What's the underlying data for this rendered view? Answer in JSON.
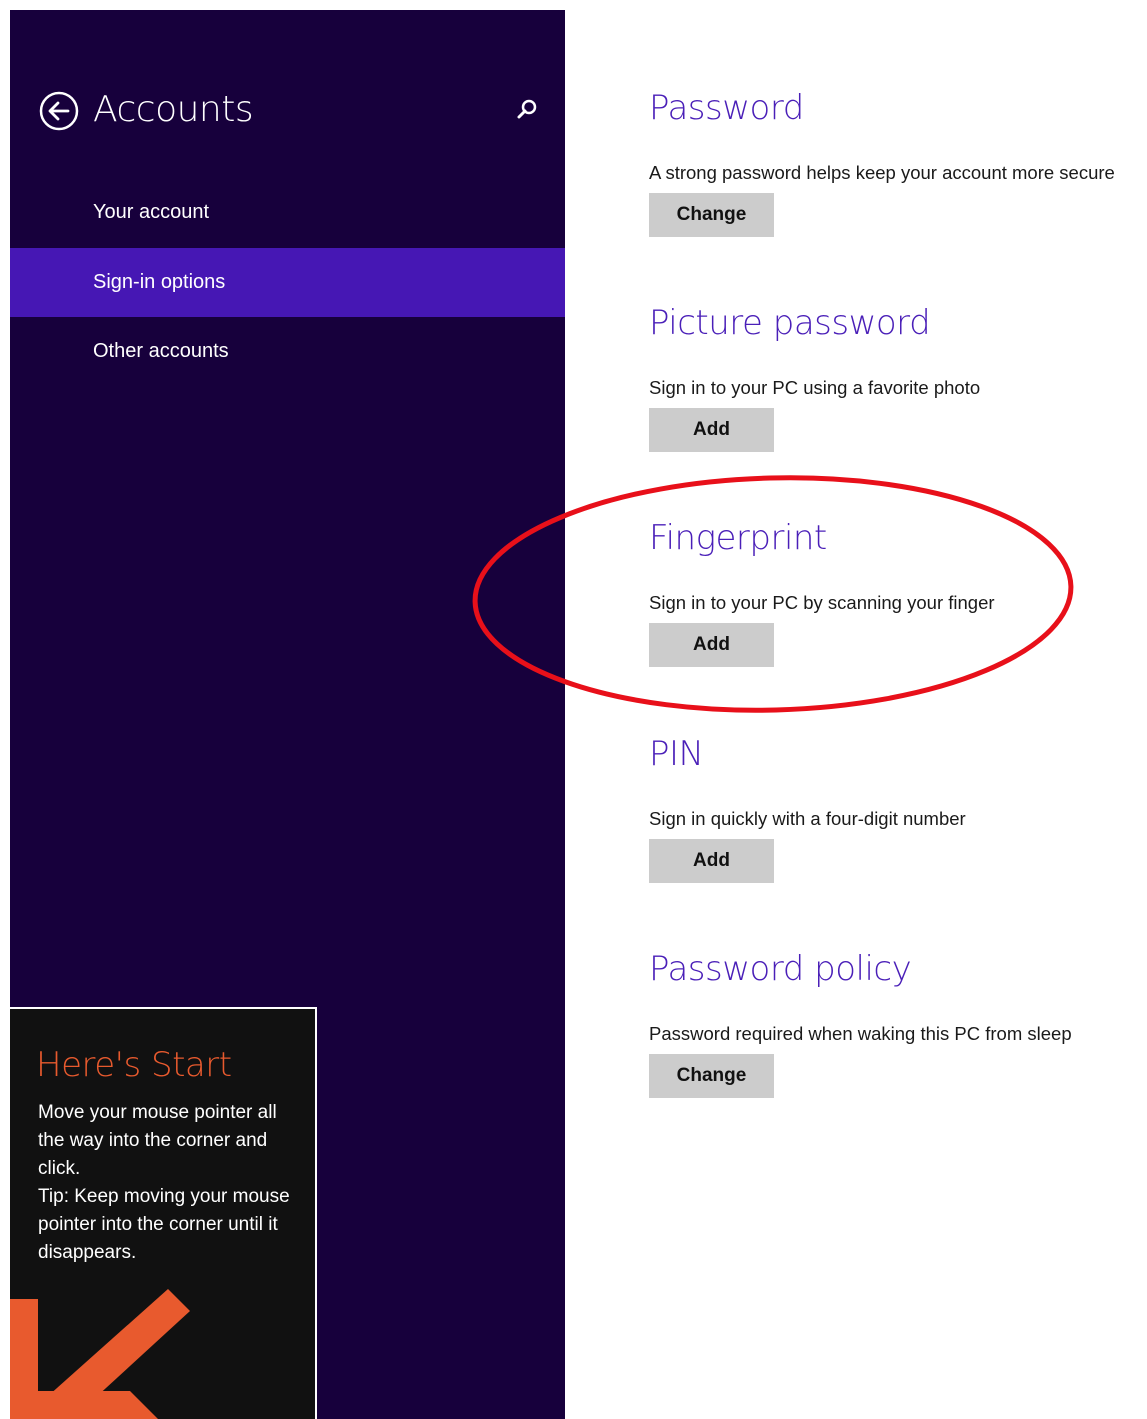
{
  "sidebar": {
    "title": "Accounts",
    "items": [
      {
        "label": "Your account",
        "active": false
      },
      {
        "label": "Sign-in options",
        "active": true
      },
      {
        "label": "Other accounts",
        "active": false
      }
    ],
    "background_color": "#17003c",
    "active_color": "#4617b4"
  },
  "tip": {
    "title": "Here's Start",
    "lines": [
      "Move your mouse pointer all the way into the corner and click.",
      "Tip: Keep moving your mouse pointer into the corner until it disappears."
    ],
    "accent_color": "#e85a2e"
  },
  "sections": [
    {
      "title": "Password",
      "description": "A strong password helps keep your account more secure",
      "button": "Change"
    },
    {
      "title": "Picture password",
      "description": "Sign in to your PC using a favorite photo",
      "button": "Add"
    },
    {
      "title": "Fingerprint",
      "description": "Sign in to your PC by scanning your finger",
      "button": "Add"
    },
    {
      "title": "PIN",
      "description": "Sign in quickly with a four-digit number",
      "button": "Add"
    },
    {
      "title": "Password policy",
      "description": "Password required when waking this PC from sleep",
      "button": "Change"
    }
  ],
  "icons": {
    "back": "back-arrow-icon",
    "search": "search-icon",
    "tip_arrow": "corner-arrow-icon"
  },
  "highlight": {
    "target": "Fingerprint",
    "color": "#e8101a"
  }
}
